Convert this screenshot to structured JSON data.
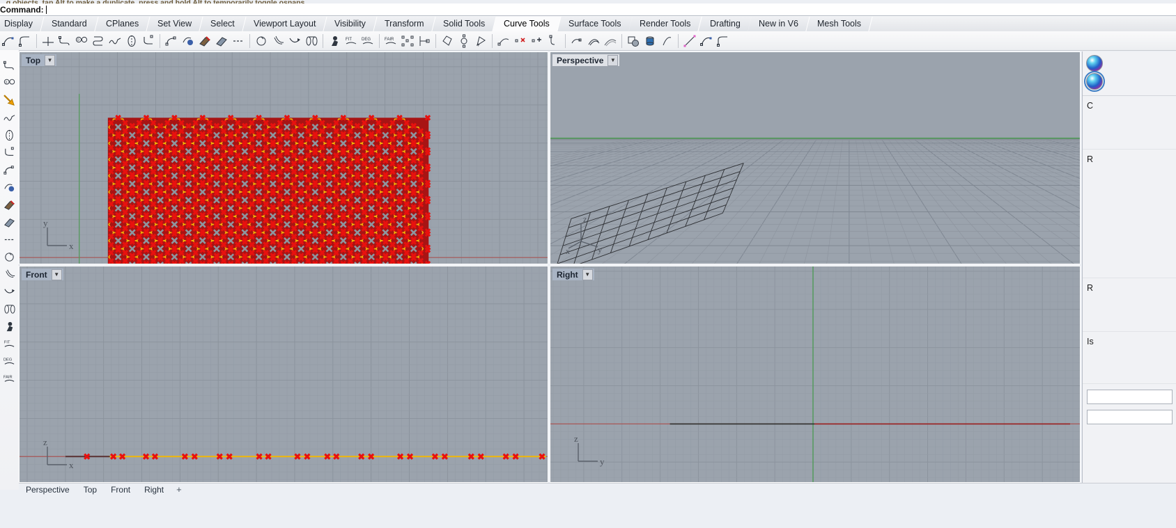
{
  "command": {
    "history_line": "...g objects, tap Alt to make a duplicate, press and hold Alt to temporarily toggle osnaps",
    "prompt_label": "Command:",
    "input_value": "",
    "input_placeholder": ""
  },
  "tabs": [
    {
      "label": "Display",
      "active": false
    },
    {
      "label": "Standard",
      "active": false
    },
    {
      "label": "CPlanes",
      "active": false
    },
    {
      "label": "Set View",
      "active": false
    },
    {
      "label": "Select",
      "active": false
    },
    {
      "label": "Viewport Layout",
      "active": false
    },
    {
      "label": "Visibility",
      "active": false
    },
    {
      "label": "Transform",
      "active": false
    },
    {
      "label": "Solid Tools",
      "active": false
    },
    {
      "label": "Curve Tools",
      "active": true
    },
    {
      "label": "Surface Tools",
      "active": false
    },
    {
      "label": "Render Tools",
      "active": false
    },
    {
      "label": "Drafting",
      "active": false
    },
    {
      "label": "New in V6",
      "active": false
    },
    {
      "label": "Mesh Tools",
      "active": false
    }
  ],
  "toolbar_icons": [
    {
      "name": "curve-arc-start-end-icon"
    },
    {
      "name": "curve-corner-icon"
    },
    {
      "name": "curve-perpendicular-icon"
    },
    {
      "name": "curve-tangent-icon"
    },
    {
      "name": "curve-through-points-icon"
    },
    {
      "name": "polyline-icon"
    },
    {
      "name": "curve-interpolate-icon"
    },
    {
      "name": "conic-icon"
    },
    {
      "name": "helix-icon"
    },
    {
      "name": "curve-from-2-views-icon"
    },
    {
      "name": "sketch-icon"
    },
    {
      "name": "project-curve-icon"
    },
    {
      "name": "pull-curve-icon"
    },
    {
      "name": "curve-boolean-icon"
    },
    {
      "name": "dash-extend-icon"
    },
    {
      "name": "offset-curve-icon"
    },
    {
      "name": "offset-multiple-icon"
    },
    {
      "name": "blend-curves-icon"
    },
    {
      "name": "pipe-revolve-icon"
    },
    {
      "name": "match-curve-icon"
    },
    {
      "name": "match-curve-2-icon"
    },
    {
      "name": "fit-curve-icon"
    },
    {
      "name": "rebuild-curve-icon"
    },
    {
      "name": "fair-curve-icon"
    },
    {
      "name": "control-points-on-icon"
    },
    {
      "name": "insert-knot-icon"
    },
    {
      "name": "curve-closed-icon"
    },
    {
      "name": "circle-control-points-icon"
    },
    {
      "name": "curve-from-object-icon"
    },
    {
      "name": "extend-curve-icon"
    },
    {
      "name": "remove-point-icon"
    },
    {
      "name": "add-point-icon"
    },
    {
      "name": "trim-curve-icon"
    },
    {
      "name": "split-curve-icon"
    },
    {
      "name": "contour-icon"
    },
    {
      "name": "section-icon"
    },
    {
      "name": "project-to-cplane-icon"
    },
    {
      "name": "revolve-icon"
    },
    {
      "name": "curve-arc-blend-icon"
    },
    {
      "name": "line-segment-icon"
    }
  ],
  "left_toolbar_icons": [
    {
      "name": "line-icon"
    },
    {
      "name": "line-from-midpoint-icon"
    },
    {
      "name": "polyline-arrow-icon"
    },
    {
      "name": "rectangle-polyline-icon"
    },
    {
      "name": "freeform-polyline-icon"
    },
    {
      "name": "curve-arc-3point-icon"
    },
    {
      "name": "curve-interpolate-points-icon"
    },
    {
      "name": "curve-control-points-icon"
    },
    {
      "name": "arc-center-icon"
    },
    {
      "name": "circle-center-radius-icon"
    },
    {
      "name": "circle-diameter-icon"
    },
    {
      "name": "circle-tangent-icon"
    },
    {
      "name": "arc-start-end-icon"
    },
    {
      "name": "curve-through-pts-icon"
    },
    {
      "name": "ellipse-icon"
    },
    {
      "name": "rectangle-corner-icon"
    },
    {
      "name": "rectangle-tangent-icon"
    },
    {
      "name": "rectangle-center-icon"
    },
    {
      "name": "polygon-star-icon"
    }
  ],
  "viewports": [
    {
      "id": "top",
      "label": "Top",
      "state": "selected",
      "caret": "▼"
    },
    {
      "id": "persp",
      "label": "Perspective",
      "state": "active",
      "caret": "▼"
    },
    {
      "id": "front",
      "label": "Front",
      "state": "selected",
      "caret": "▼"
    },
    {
      "id": "right",
      "label": "Right",
      "state": "selected",
      "caret": "▼"
    }
  ],
  "gizmos": {
    "top": {
      "a": "y",
      "b": "x"
    },
    "persp": {
      "a": "z",
      "b": "x",
      "c": "y"
    },
    "front": {
      "a": "z",
      "b": "x"
    },
    "right": {
      "a": "z",
      "b": "y"
    }
  },
  "bottom_tabs": [
    {
      "label": "Perspective",
      "active": false
    },
    {
      "label": "Top",
      "active": false
    },
    {
      "label": "Front",
      "active": false
    },
    {
      "label": "Right",
      "active": false
    },
    {
      "label": "+",
      "active": false
    }
  ],
  "right_panel": {
    "swatch_top_name": "material-sphere-icon",
    "swatch_selected_name": "material-sphere-selected-icon",
    "rows": [
      {
        "text": "C"
      },
      {
        "text": "R"
      },
      {
        "text": "R"
      },
      {
        "text": "Is"
      }
    ]
  },
  "colors": {
    "viewport_bg": "#9ba3ad",
    "grid_line": "#8e969f",
    "grid_major": "#7f8791",
    "axis_x_red": "#b14a4a",
    "axis_y_green": "#49a052",
    "selection_red": "#a81414",
    "selection_highlight": "#e8110f",
    "hex_outline_yellow": "#f2b705",
    "panel_bg": "#f1f2f5",
    "tab_active": "#fbfbfc",
    "title_selected_bg": "#a9b4c4"
  },
  "model": {
    "description": "hexagonal honeycomb array, selected",
    "hex_cols": 22,
    "hex_rows": 11
  }
}
